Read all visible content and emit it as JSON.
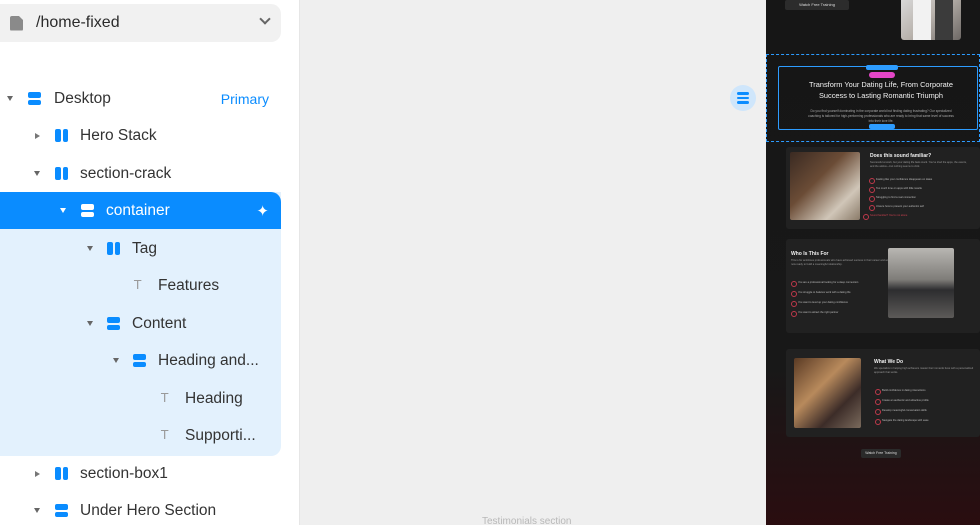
{
  "page_selector": {
    "name": "/home-fixed"
  },
  "layers": {
    "items": [
      {
        "label": "Desktop",
        "badge": "Primary"
      },
      {
        "label": "Hero Stack"
      },
      {
        "label": "section-crack"
      },
      {
        "label": "container"
      },
      {
        "label": "Tag"
      },
      {
        "label": "Features"
      },
      {
        "label": "Content"
      },
      {
        "label": "Heading and..."
      },
      {
        "label": "Heading"
      },
      {
        "label": "Supporti..."
      },
      {
        "label": "section-box1"
      },
      {
        "label": "Under Hero Section"
      }
    ]
  },
  "canvas": {
    "bottom_label": "Testimonials section"
  },
  "preview": {
    "hero_button": "Watch Free Training",
    "heading": "Transform Your Dating Life, From Corporate Success to Lasting Romantic Triumph",
    "supporting": "Do you find yourself dominating in the corporate world but finding dating frustrating? Our specialized coaching is tailored for high-performing professionals who are ready to bring that same level of success into their love life.",
    "card1": {
      "title": "Does this sound familiar?",
      "text": "Successful at work, but your dating life feels stuck. You've tried the apps, the events, and the advice—but nothing seems to click.",
      "bullets": [
        "Feeling like your confidence disappears on dates",
        "Too much time on apps with little results",
        "Struggling to find a real connection",
        "Unsure how to present your authentic self"
      ],
      "link": "Sound familiar? You're not alone"
    },
    "card2": {
      "title": "Who Is This For",
      "text": "This is for ambitious professionals who have achieved success in their career and are now ready to build a meaningful relationship.",
      "bullets": [
        "You are a professional looking for a deep connection",
        "You struggle to balance work with a dating life",
        "You want to level up your dating confidence",
        "You want to attract the right partner"
      ]
    },
    "card3": {
      "title": "What We Do",
      "text": "We specialize in helping high achievers master their romantic lives with a personalized approach that works.",
      "bullets": [
        "Build confidence in dating interactions",
        "Create an authentic and attractive profile",
        "Develop meaningful conversation skills",
        "Navigate the dating landscape with ease"
      ]
    },
    "bottom_button": "Watch Free Training"
  }
}
